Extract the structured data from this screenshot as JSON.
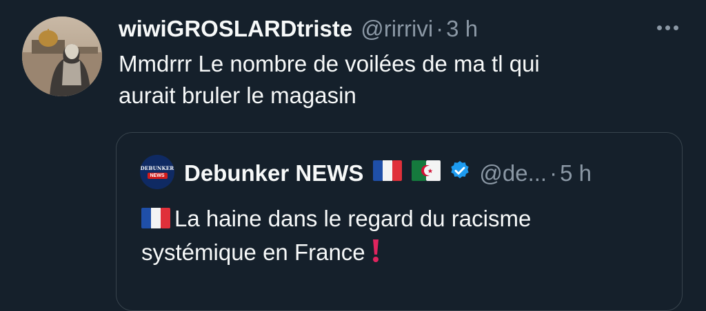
{
  "tweet": {
    "author": {
      "display_name": "wiwiGROSLARDtriste",
      "handle": "@rirrivi"
    },
    "separator": "·",
    "time": "3 h",
    "text_lines": [
      "Mmdrrr Le nombre de voilées de ma tl qui",
      "aurait bruler le magasin"
    ],
    "menu_icon": "more-horizontal-icon"
  },
  "quote": {
    "author": {
      "display_name": "Debunker NEWS",
      "handle": "@de...",
      "avatar_text_top": "DEBUNKER",
      "avatar_text_bottom": "NEWS",
      "flags": [
        "france-flag-icon",
        "algeria-flag-icon"
      ],
      "verified_icon": "verified-badge-icon"
    },
    "separator": "·",
    "time": "5 h",
    "text_lines": [
      "La haine dans le regard du racisme",
      "systémique en France"
    ],
    "text_leading_icon": "france-flag-icon",
    "text_trailing_icon": "red-exclamation-icon"
  },
  "colors": {
    "background": "#15202b",
    "text_primary": "#f7f9f9",
    "text_secondary": "#8b98a5",
    "border": "#38444d",
    "verified_blue": "#1d9bf0",
    "exclamation_red": "#e0245e"
  }
}
